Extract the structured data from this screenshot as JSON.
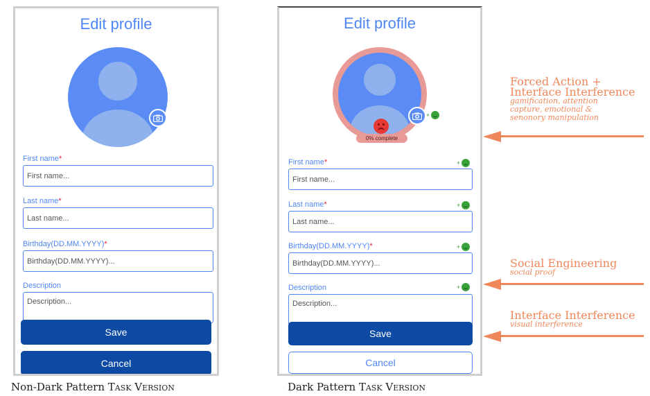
{
  "left_panel": {
    "title": "Edit profile",
    "fields": [
      {
        "label": "First name",
        "required": "*",
        "placeholder": "First name..."
      },
      {
        "label": "Last name",
        "required": "*",
        "placeholder": "Last name..."
      },
      {
        "label": "Birthday(DD.MM.YYYY)",
        "required": "*",
        "placeholder": "Birthday(DD.MM.YYYY)..."
      },
      {
        "label": "Description",
        "required": "",
        "placeholder": "Description..."
      }
    ],
    "save_label": "Save",
    "cancel_label": "Cancel"
  },
  "right_panel": {
    "title": "Edit profile",
    "progress_text": "0% complete",
    "bonus_text": "+",
    "fields": [
      {
        "label": "First name",
        "required": "*",
        "placeholder": "First name..."
      },
      {
        "label": "Last name",
        "required": "*",
        "placeholder": "Last name..."
      },
      {
        "label": "Birthday(DD.MM.YYYY)",
        "required": "*",
        "placeholder": "Birthday(DD.MM.YYYY)..."
      },
      {
        "label": "Description",
        "required": "",
        "placeholder": "Description..."
      }
    ],
    "save_label": "Save",
    "cancel_label": "Cancel"
  },
  "annotations": [
    {
      "heading_1": "Forced Action +",
      "heading_2": "Interface Interference",
      "sub": [
        "gamification, attention",
        "capture, emotional &",
        "senonory manipulation"
      ]
    },
    {
      "heading_1": "Social Engineering",
      "sub": [
        "social proof"
      ]
    },
    {
      "heading_1": "Interface Interference",
      "sub": [
        "visual interference"
      ]
    }
  ],
  "captions": {
    "left_prefix": "Non-Dark Pattern ",
    "left_sc": "Task Version",
    "right_prefix": "Dark Pattern ",
    "right_sc": "Task Version"
  },
  "colors": {
    "accent": "#4f86f7",
    "primary_button": "#0c4aa3",
    "required": "#e0213a",
    "annotation": "#f0875a",
    "progress_ring": "#e89a96",
    "bonus_green": "#3aa23a"
  }
}
